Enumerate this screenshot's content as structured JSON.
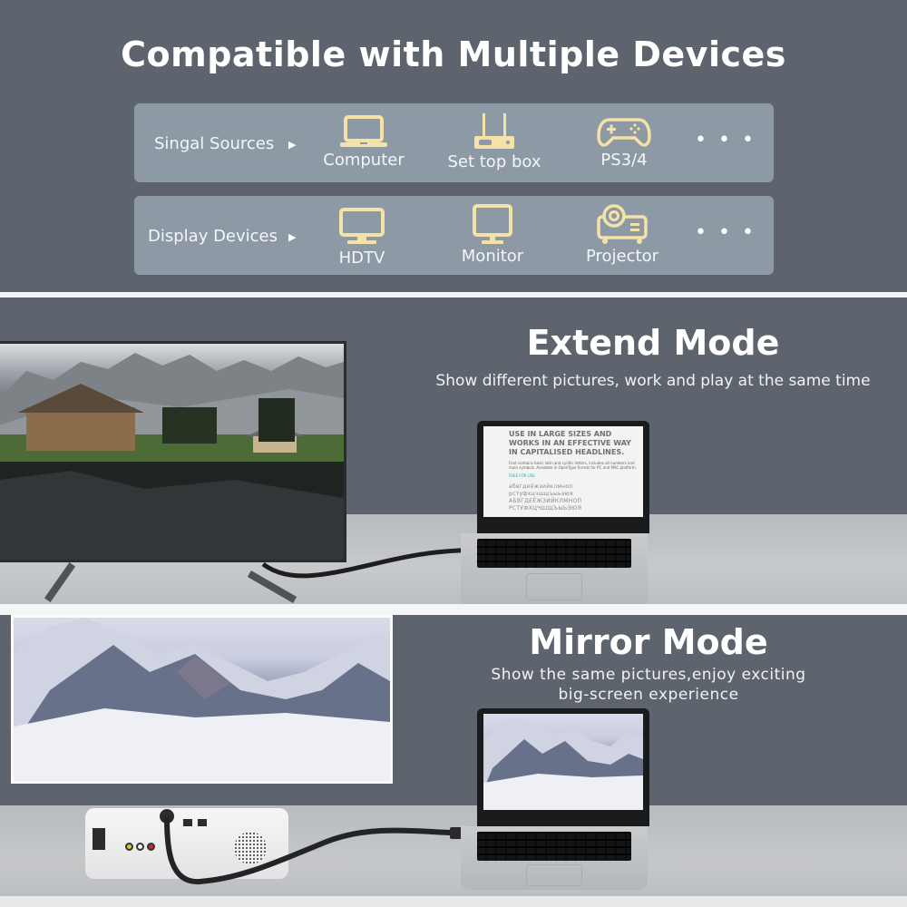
{
  "header": {
    "title": "Compatible with Multiple Devices"
  },
  "signal_sources": {
    "label": "Singal Sources",
    "arrow": "▶",
    "devices": [
      {
        "name": "Computer",
        "icon": "laptop-icon"
      },
      {
        "name": "Set top box",
        "icon": "set-top-box-icon"
      },
      {
        "name": "PS3/4",
        "icon": "gamepad-icon"
      }
    ],
    "more": "• • •"
  },
  "display_devices": {
    "label": "Display Devices",
    "arrow": "▶",
    "devices": [
      {
        "name": "HDTV",
        "icon": "tv-icon"
      },
      {
        "name": "Monitor",
        "icon": "monitor-icon"
      },
      {
        "name": "Projector",
        "icon": "projector-icon"
      }
    ],
    "more": "• • •"
  },
  "extend_mode": {
    "title": "Extend Mode",
    "subtitle": "Show different pictures, work and play at the same time",
    "laptop_screen": {
      "headline": "USE IN LARGE SIZES AND WORKS IN AN EFFECTIVE WAY IN CAPITALISED HEADLINES.",
      "body": "Font contains basic latin and cyrillic letters, includes all numbers and main symbols. Available in OpenType format for PC and MAC platform.",
      "free": "FREE FOR USE",
      "cyrillic_lower_1": "абвгдеёжзийклмноп",
      "cyrillic_lower_2": "рстуфхцчшщъыьэюя",
      "cyrillic_upper_1": "АБВГДЕЁЖЗИЙКЛМНОП",
      "cyrillic_upper_2": "РСТУФХЦЧШЩЪЫЬЭЮЯ"
    }
  },
  "mirror_mode": {
    "title": "Mirror Mode",
    "subtitle_line1": "Show the same pictures,enjoy exciting",
    "subtitle_line2": "big-screen experience"
  },
  "colors": {
    "background": "#5d646d",
    "panel": "#8e99a6",
    "icon": "#f5e2a6",
    "text": "#ffffff",
    "floor": "#c2c4c6"
  }
}
